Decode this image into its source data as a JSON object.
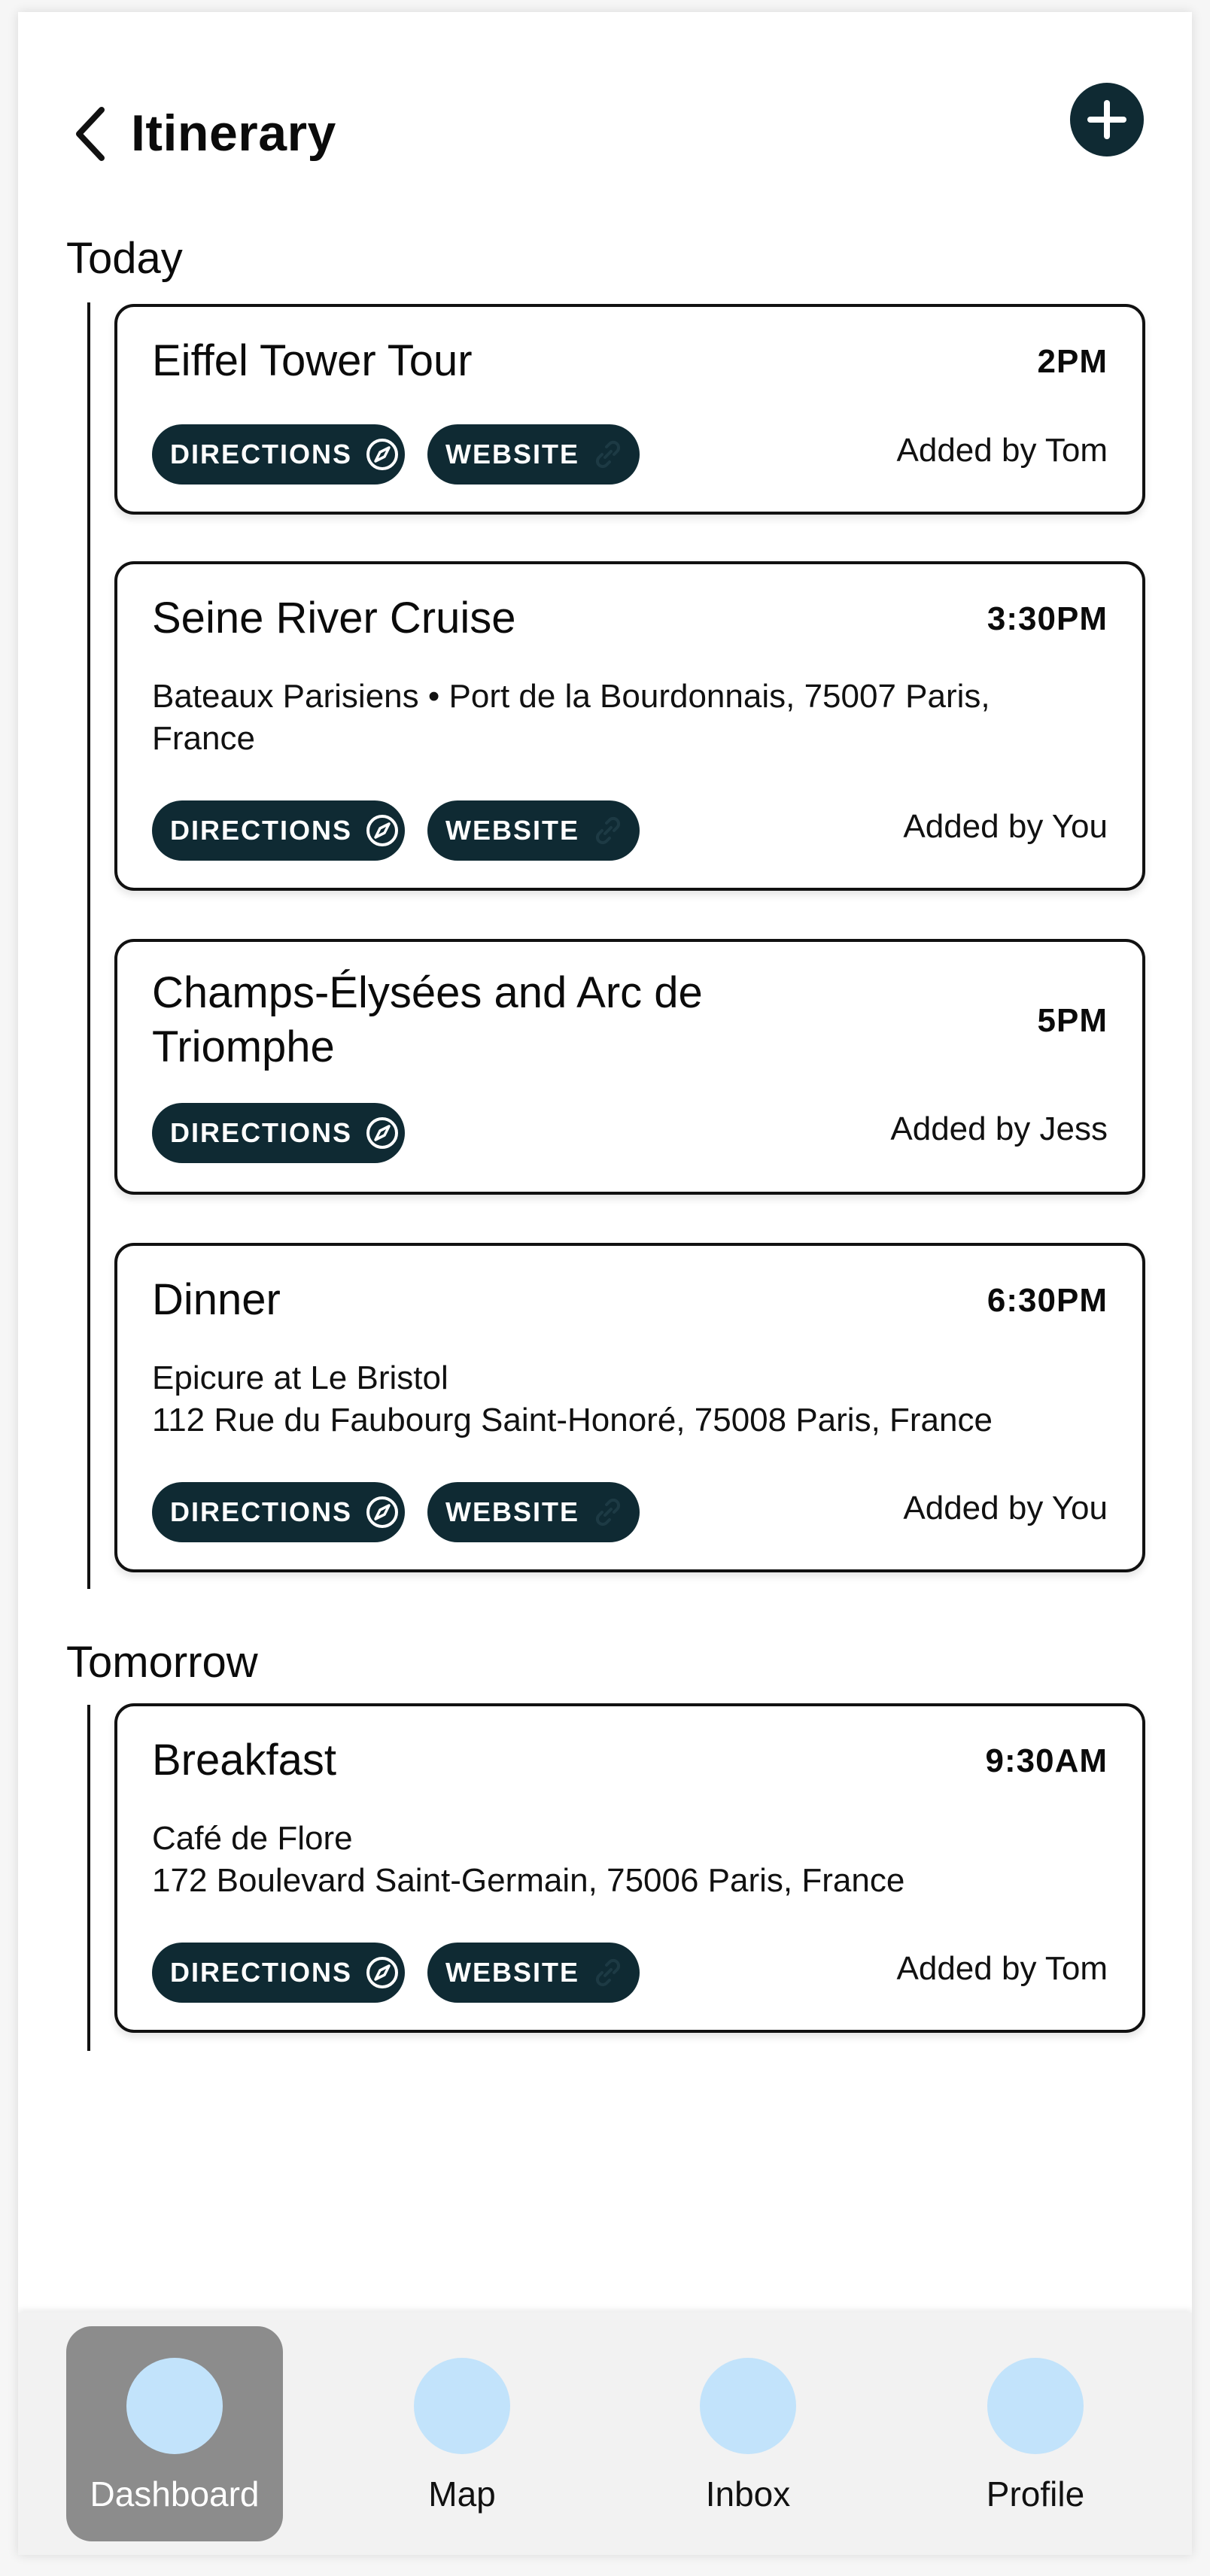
{
  "header": {
    "title": "Itinerary",
    "back_icon": "chevron-left-icon",
    "add_icon": "plus-icon"
  },
  "sections": [
    {
      "title": "Today",
      "items": [
        {
          "title": "Eiffel Tower Tour",
          "time": "2PM",
          "address": "",
          "directions_label": "DIRECTIONS",
          "website_label": "WEBSITE",
          "added_by": "Added by Tom"
        },
        {
          "title": "Seine River Cruise",
          "time": "3:30PM",
          "address": "Bateaux Parisiens • Port de la Bourdonnais, 75007 Paris, France",
          "directions_label": "DIRECTIONS",
          "website_label": "WEBSITE",
          "added_by": "Added by You"
        },
        {
          "title": "Champs-Élysées and Arc de Triomphe",
          "time": "5PM",
          "address": "",
          "directions_label": "DIRECTIONS",
          "website_label": "",
          "added_by": "Added by Jess"
        },
        {
          "title": "Dinner",
          "time": "6:30PM",
          "address_line1": "Epicure at Le Bristol",
          "address_line2": "112 Rue du Faubourg Saint-Honoré, 75008 Paris, France",
          "directions_label": "DIRECTIONS",
          "website_label": "WEBSITE",
          "added_by": "Added by You"
        }
      ]
    },
    {
      "title": "Tomorrow",
      "items": [
        {
          "title": "Breakfast",
          "time": "9:30AM",
          "address_line1": "Café de Flore",
          "address_line2": "172 Boulevard Saint-Germain, 75006 Paris, France",
          "directions_label": "DIRECTIONS",
          "website_label": "WEBSITE",
          "added_by": "Added by Tom"
        }
      ]
    }
  ],
  "nav": {
    "items": [
      {
        "label": "Dashboard",
        "active": true
      },
      {
        "label": "Map",
        "active": false
      },
      {
        "label": "Inbox",
        "active": false
      },
      {
        "label": "Profile",
        "active": false
      }
    ]
  },
  "colors": {
    "chip": "#0f2a33",
    "nav_dot": "#c2e3fb",
    "nav_active": "#8c8c8c",
    "nav_bg": "#f2f2f2"
  }
}
